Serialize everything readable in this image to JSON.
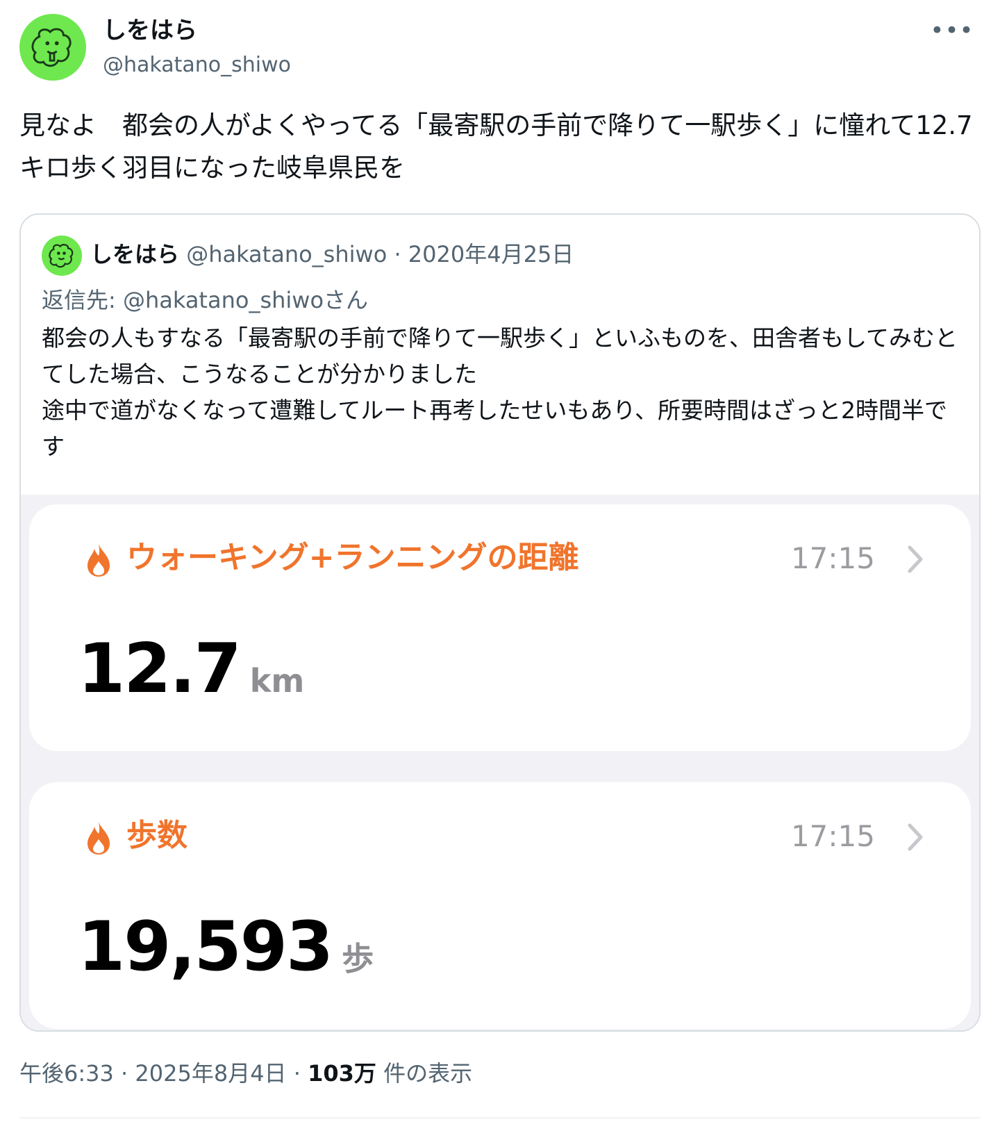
{
  "author": {
    "display_name": "しをはら",
    "handle": "@hakatano_shiwo"
  },
  "more_label": "•••",
  "tweet_text": "見なよ　都会の人がよくやってる「最寄駅の手前で降りて一駅歩く」に憧れて12.7キロ歩く羽目になった岐阜県民を",
  "quote": {
    "display_name": "しをはら",
    "handle": "@hakatano_shiwo",
    "separator": " · ",
    "date": "2020年4月25日",
    "reply_to": "返信先: @hakatano_shiwoさん",
    "text_line1": "都会の人もすなる「最寄駅の手前で降りて一駅歩く」といふものを、田舎者もしてみむとてした場合、こうなることが分かりました",
    "text_line2": "途中で道がなくなって遭難してルート再考したせいもあり、所要時間はざっと2時間半です",
    "image": {
      "accent_color": "#f0742c",
      "cards": [
        {
          "icon": "flame-icon",
          "title": "ウォーキング+ランニングの距離",
          "time": "17:15",
          "value": "12.7",
          "unit": "km"
        },
        {
          "icon": "flame-icon",
          "title": "歩数",
          "time": "17:15",
          "value": "19,593",
          "unit": "歩"
        }
      ]
    }
  },
  "footer": {
    "time": "午後6:33",
    "separator": " · ",
    "date": "2025年8月4日",
    "views_count": "103万",
    "views_label": " 件の表示"
  },
  "colors": {
    "avatar_bg": "#6ee84e",
    "text_primary": "#0f1419",
    "text_secondary": "#536471"
  }
}
